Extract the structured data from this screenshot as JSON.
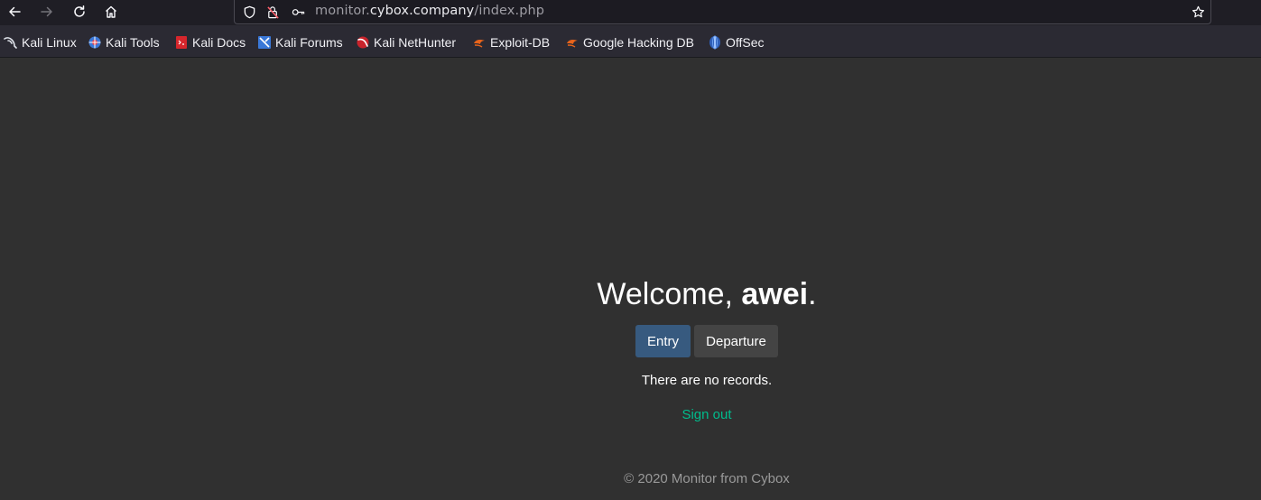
{
  "browser": {
    "url": {
      "prefix": "monitor.",
      "domain": "cybox.company",
      "path": "/index.php"
    },
    "icons": {
      "back": "arrow-left-icon",
      "forward": "arrow-right-icon",
      "reload": "reload-icon",
      "home": "home-icon",
      "shield": "shield-icon",
      "insecure_lock": "insecure-lock-icon",
      "key": "key-icon",
      "bookmark_star": "star-icon"
    }
  },
  "bookmarks": [
    {
      "label": "Kali Linux"
    },
    {
      "label": "Kali Tools"
    },
    {
      "label": "Kali Docs"
    },
    {
      "label": "Kali Forums"
    },
    {
      "label": "Kali NetHunter"
    },
    {
      "label": "Exploit-DB"
    },
    {
      "label": "Google Hacking DB"
    },
    {
      "label": "OffSec"
    }
  ],
  "page": {
    "welcome_prefix": "Welcome, ",
    "username": "awei",
    "welcome_suffix": ".",
    "entry_label": "Entry",
    "departure_label": "Departure",
    "no_records": "There are no records.",
    "signout_label": "Sign out",
    "footer": "© 2020 Monitor from Cybox"
  },
  "colors": {
    "background": "#303030",
    "primary_button": "#375a7f",
    "secondary_button": "#444444",
    "link": "#00bc8c",
    "footer_text": "#999999"
  }
}
